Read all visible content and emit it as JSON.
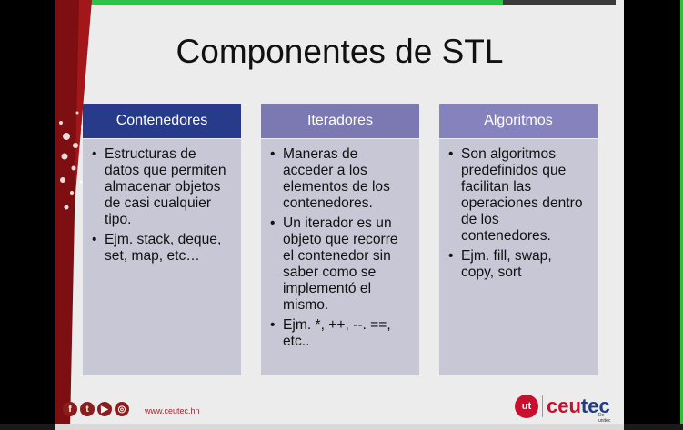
{
  "slide": {
    "title": "Componentes de STL",
    "columns": [
      {
        "heading": "Contenedores",
        "color": "#283a8a",
        "items": [
          "Estructuras de datos que permiten almacenar objetos de casi cualquier tipo.",
          "Ejm. stack, deque, set, map, etc…"
        ]
      },
      {
        "heading": "Iteradores",
        "color": "#7b78b2",
        "items": [
          "Maneras de acceder a los elementos de los contenedores.",
          "Un iterador es un objeto que recorre el contenedor sin saber como se implementó el mismo.",
          "Ejm. *, ++, --. ==, etc.."
        ]
      },
      {
        "heading": "Algoritmos",
        "color": "#8682bd",
        "items": [
          "Son algoritmos predefinidos que facilitan las operaciones dentro de los contenedores.",
          "Ejm. fill, swap, copy, sort"
        ]
      }
    ],
    "footer": {
      "social_icons": [
        "facebook-icon",
        "twitter-icon",
        "youtube-icon",
        "instagram-icon"
      ],
      "url": "www.ceutec.hn",
      "logo_badge": "ut",
      "logo_text_a": "ceu",
      "logo_text_b": "tec",
      "logo_sub": "De unitec"
    }
  },
  "colors": {
    "accent_red": "#a3171b",
    "top_green": "#2ec24a"
  }
}
